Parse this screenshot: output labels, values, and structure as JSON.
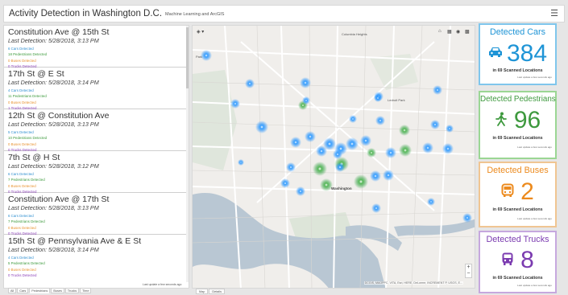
{
  "header": {
    "title": "Activity Detection in Washington D.C.",
    "subtitle": "Machine Learning and ArcGIS",
    "menu_icon": "hamburger-icon"
  },
  "list": {
    "items": [
      {
        "location": "Constitution Ave @ 15th St",
        "last_detection": "Last Detection: 5/28/2018, 3:13 PM",
        "cars": "6 Cars Detected",
        "peds": "18 Pedestrians Detected",
        "buses": "0 Buses Detected",
        "trucks": "0 Trucks Detected"
      },
      {
        "location": "17th St @ E St",
        "last_detection": "Last Detection: 5/28/2018, 3:14 PM",
        "cars": "4 Cars Detected",
        "peds": "11 Pedestrians Detected",
        "buses": "0 Buses Detected",
        "trucks": "1 Trucks Detected"
      },
      {
        "location": "12th St @ Constitution Ave",
        "last_detection": "Last Detection: 5/28/2018, 3:13 PM",
        "cars": "5 Cars Detected",
        "peds": "10 Pedestrians Detected",
        "buses": "0 Buses Detected",
        "trucks": "0 Trucks Detected"
      },
      {
        "location": "7th St @ H St",
        "last_detection": "Last Detection: 5/28/2018, 3:12 PM",
        "cars": "6 Cars Detected",
        "peds": "7 Pedestrians Detected",
        "buses": "0 Buses Detected",
        "trucks": "0 Trucks Detected"
      },
      {
        "location": "Constitution Ave @ 17th St",
        "last_detection": "Last Detection: 5/28/2018, 3:13 PM",
        "cars": "6 Cars Detected",
        "peds": "7 Pedestrians Detected",
        "buses": "0 Buses Detected",
        "trucks": "0 Trucks Detected"
      },
      {
        "location": "15th St @ Pennsylvania Ave & E St",
        "last_detection": "Last Detection: 5/28/2018, 3:14 PM",
        "cars": "4 Cars Detected",
        "peds": "5 Pedestrians Detected",
        "buses": "0 Buses Detected",
        "trucks": "0 Trucks Detected"
      }
    ],
    "last_update": "Last update a few seconds ago",
    "tabs": [
      "All",
      "Cars",
      "Pedestrians",
      "Buses",
      "Trucks",
      "Time"
    ],
    "active_tab": "Pedestrians"
  },
  "map": {
    "labels": {
      "columbia_heights": "Columbia Heights",
      "ledroit_park": "Ledroit Park",
      "washington": "Washington",
      "park": "Park"
    },
    "attribution": "DCGIS, MAOPPC, VITA, Esri, HERE, DeLorme, INCREMENT P, USGS, E...",
    "zoom_in": "+",
    "zoom_out": "−",
    "tabs": [
      "Map",
      "Details"
    ],
    "active_tab": "Map",
    "colors": {
      "car_dot": "#1e90ff",
      "ped_dot": "#3aa64a",
      "water": "#b9c7d3",
      "road": "#ffffff"
    }
  },
  "cards": {
    "cars": {
      "title": "Detected Cars",
      "value": "384",
      "sub": "in 69 Scanned Locations",
      "updated": "Last update a few seconds ago",
      "icon": "car-icon",
      "color": "#1e94d6"
    },
    "peds": {
      "title": "Detected Pedestrians",
      "value": "96",
      "sub": "in 69 Scanned Locations",
      "updated": "Last update a few seconds ago",
      "icon": "pedestrian-icon",
      "color": "#3e993e"
    },
    "buses": {
      "title": "Detected Buses",
      "value": "2",
      "sub": "in 69 Scanned Locations",
      "updated": "Last update a few seconds ago",
      "icon": "bus-icon",
      "color": "#ec8a1d"
    },
    "trucks": {
      "title": "Detected Trucks",
      "value": "8",
      "sub": "in 69 Scanned Locations",
      "updated": "Last update a few seconds ago",
      "icon": "truck-icon",
      "color": "#7b3bb0"
    }
  }
}
